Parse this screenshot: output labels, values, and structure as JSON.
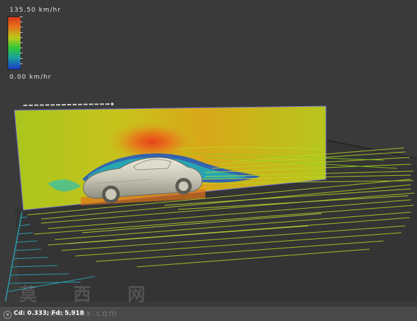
{
  "legend": {
    "max_label": "135.50 km/hr",
    "min_label": "0.00 km/hr",
    "colors": [
      "#d63a1a",
      "#e6701a",
      "#b8cc1a",
      "#2ec63a",
      "#1aa0a0",
      "#1a3ac8"
    ]
  },
  "status": {
    "text": "Cd: 0.333; Fd: 5.918",
    "close_icon": "close-icon"
  },
  "watermark": {
    "chars": "莫 西 网",
    "url": "www.mx.com"
  }
}
